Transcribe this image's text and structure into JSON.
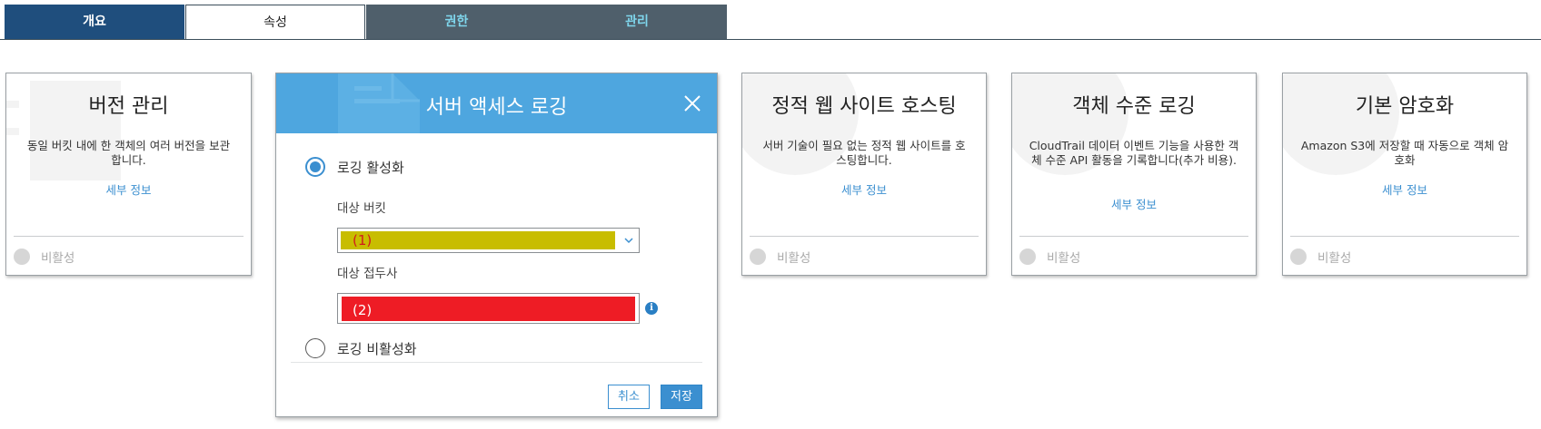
{
  "tabs": [
    {
      "label": "개요",
      "active": false
    },
    {
      "label": "속성",
      "active": true
    },
    {
      "label": "권한",
      "active": false
    },
    {
      "label": "관리",
      "active": false
    }
  ],
  "cards": {
    "versioning": {
      "title": "버전 관리",
      "desc": "동일 버킷 내에 한 객체의 여러 버전을 보관합니다.",
      "link": "세부 정보",
      "status": "비활성"
    },
    "website": {
      "title": "정적 웹 사이트 호스팅",
      "desc": "서버 기술이 필요 없는 정적 웹 사이트를 호스팅합니다.",
      "link": "세부 정보",
      "status": "비활성"
    },
    "object_logging": {
      "title": "객체 수준 로깅",
      "desc": "CloudTrail 데이터 이벤트 기능을 사용한 객체 수준 API 활동을 기록합니다(추가 비용).",
      "link": "세부 정보",
      "status": "비활성"
    },
    "encryption": {
      "title": "기본 암호화",
      "desc": "Amazon S3에 저장할 때 자동으로 객체 암호화",
      "link": "세부 정보",
      "status": "비활성"
    }
  },
  "modal": {
    "title": "서버 액세스 로깅",
    "enable_label": "로깅 활성화",
    "target_bucket_label": "대상 버킷",
    "target_bucket_value": "(1)",
    "target_prefix_label": "대상 접두사",
    "target_prefix_value": "(2)",
    "disable_label": "로깅 비활성화",
    "selected_option": "로깅 활성화",
    "cancel_label": "취소",
    "save_label": "저장"
  },
  "colors": {
    "accent": "#3b8fd0",
    "header": "#4ea6df",
    "redaction_bucket": "#c8bd00",
    "redaction_prefix": "#ee1c25"
  }
}
